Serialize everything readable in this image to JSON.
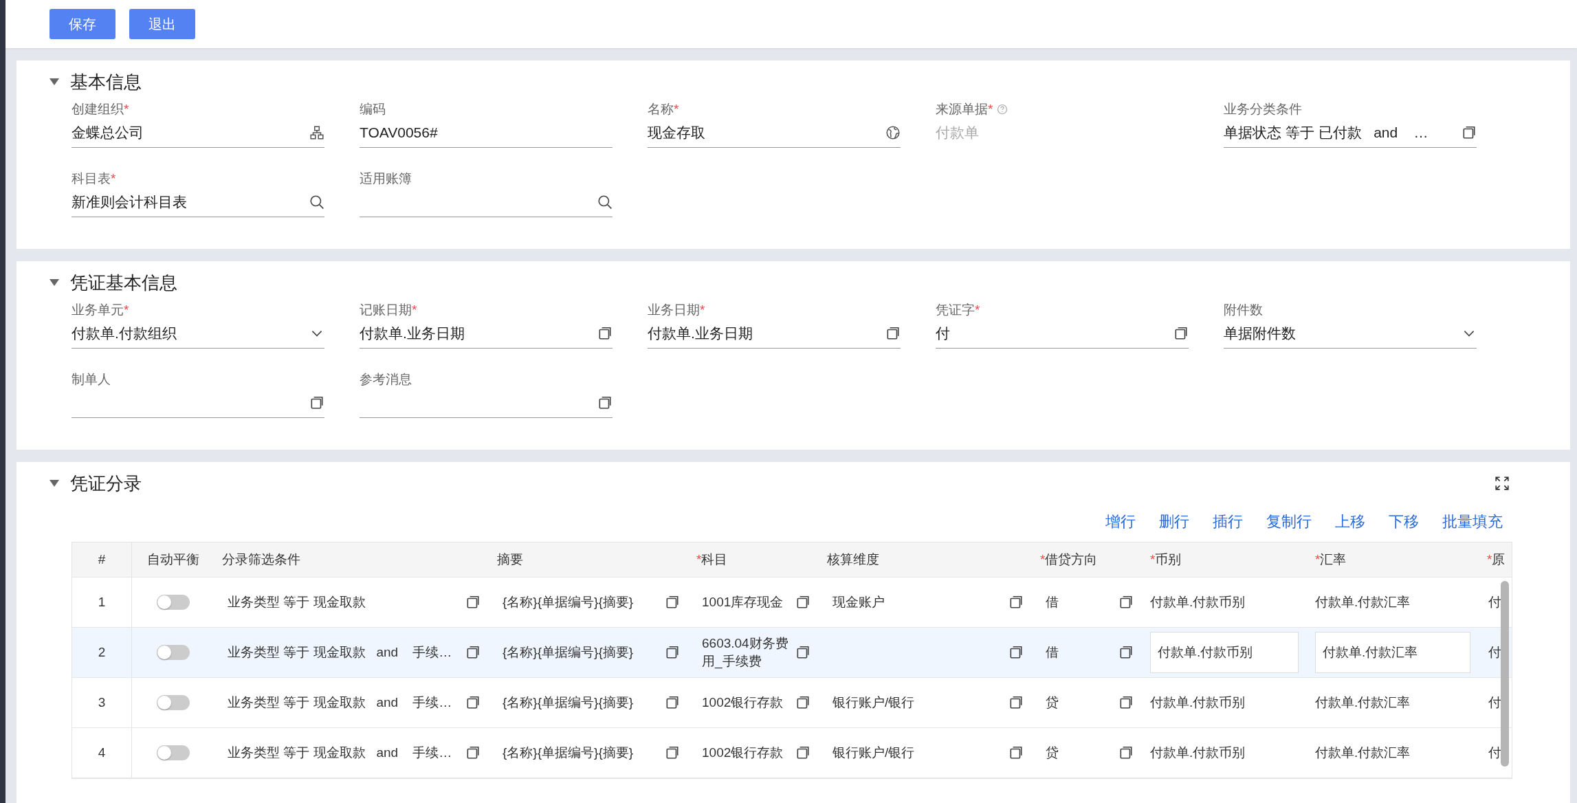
{
  "toolbar": {
    "buttons": [
      "保存",
      "退出"
    ]
  },
  "sections": [
    {
      "title": "基本信息",
      "expanded": true,
      "fields": [
        {
          "label": "创建组织",
          "marker": "*",
          "disabled": false,
          "value": "金蝶总公司",
          "kind": "orgpicker"
        },
        {
          "label": "编码",
          "disabled": false,
          "value": "TOAV0056#",
          "kind": "text"
        },
        {
          "label": "名称",
          "marker": "*",
          "disabled": false,
          "value": "现金存取",
          "kind": "multilang"
        },
        {
          "label": "来源单据",
          "marker": "*",
          "help": true,
          "disabled": true,
          "value": "付款单",
          "kind": "text"
        },
        {
          "label": "业务分类条件",
          "disabled": false,
          "value": "单据状态 等于 已付款   and    …",
          "kind": "formula"
        },
        {
          "label": "科目表",
          "marker": "*",
          "disabled": false,
          "value": "新准则会计科目表",
          "kind": "lookup"
        },
        {
          "label": "适用账簿",
          "disabled": false,
          "kind": "lookup"
        }
      ]
    },
    {
      "title": "凭证基本信息",
      "expanded": true,
      "fields": [
        {
          "label": "业务单元",
          "marker": "*",
          "disabled": false,
          "value": "付款单.付款组织",
          "kind": "select"
        },
        {
          "label": "记账日期",
          "marker": "*",
          "disabled": false,
          "value": "付款单.业务日期",
          "kind": "formula"
        },
        {
          "label": "业务日期",
          "marker": "*",
          "disabled": false,
          "value": "付款单.业务日期",
          "kind": "formula"
        },
        {
          "label": "凭证字",
          "marker": "*",
          "disabled": false,
          "value": "付",
          "kind": "formula"
        },
        {
          "label": "附件数",
          "disabled": false,
          "value": "单据附件数",
          "kind": "select"
        },
        {
          "label": "制单人",
          "disabled": false,
          "kind": "formula"
        },
        {
          "label": "参考消息",
          "disabled": false,
          "kind": "formula"
        }
      ]
    }
  ],
  "entries": {
    "title": "凭证分录",
    "expanded": true,
    "actions": [
      "增行",
      "删行",
      "插行",
      "复制行",
      "上移",
      "下移",
      "批量填充"
    ],
    "columns": [
      {
        "label": "#"
      },
      {
        "label": "自动平衡"
      },
      {
        "label": "分录筛选条件"
      },
      {
        "label": "摘要"
      },
      {
        "label": "科目",
        "marker": "*"
      },
      {
        "label": "核算维度"
      },
      {
        "label": "借贷方向",
        "marker": "*"
      },
      {
        "label": "币别",
        "marker": "*"
      },
      {
        "label": "汇率",
        "marker": "*"
      },
      {
        "label": "原",
        "marker": "*"
      }
    ],
    "rows": [
      {
        "no": "1",
        "selected": false,
        "on": false,
        "condition": "业务类型 等于 现金取款",
        "summary": "{名称}{单据编号}{摘要}",
        "account": "1001库存现金",
        "dimension": "现金账户",
        "direction": "借",
        "currency": "付款单.付款币别",
        "rate": "付款单.付款汇率",
        "original": "付"
      },
      {
        "no": "2",
        "selected": true,
        "on": false,
        "condition": "业务类型 等于 现金取款   and    手续…",
        "summary": "{名称}{单据编号}{摘要}",
        "account": "6603.04财务费用_手续费",
        "direction": "借",
        "currency": "付款单.付款币别",
        "rate": "付款单.付款汇率",
        "original": "付"
      },
      {
        "no": "3",
        "selected": false,
        "on": false,
        "condition": "业务类型 等于 现金取款   and    手续…",
        "summary": "{名称}{单据编号}{摘要}",
        "account": "1002银行存款",
        "dimension": "银行账户/银行",
        "direction": "贷",
        "currency": "付款单.付款币别",
        "rate": "付款单.付款汇率",
        "original": "付"
      },
      {
        "no": "4",
        "selected": false,
        "on": false,
        "condition": "业务类型 等于 现金取款   and    手续…",
        "summary": "{名称}{单据编号}{摘要}",
        "account": "1002银行存款",
        "dimension": "银行账户/银行",
        "direction": "贷",
        "currency": "付款单.付款币别",
        "rate": "付款单.付款汇率",
        "original": "付"
      }
    ]
  }
}
